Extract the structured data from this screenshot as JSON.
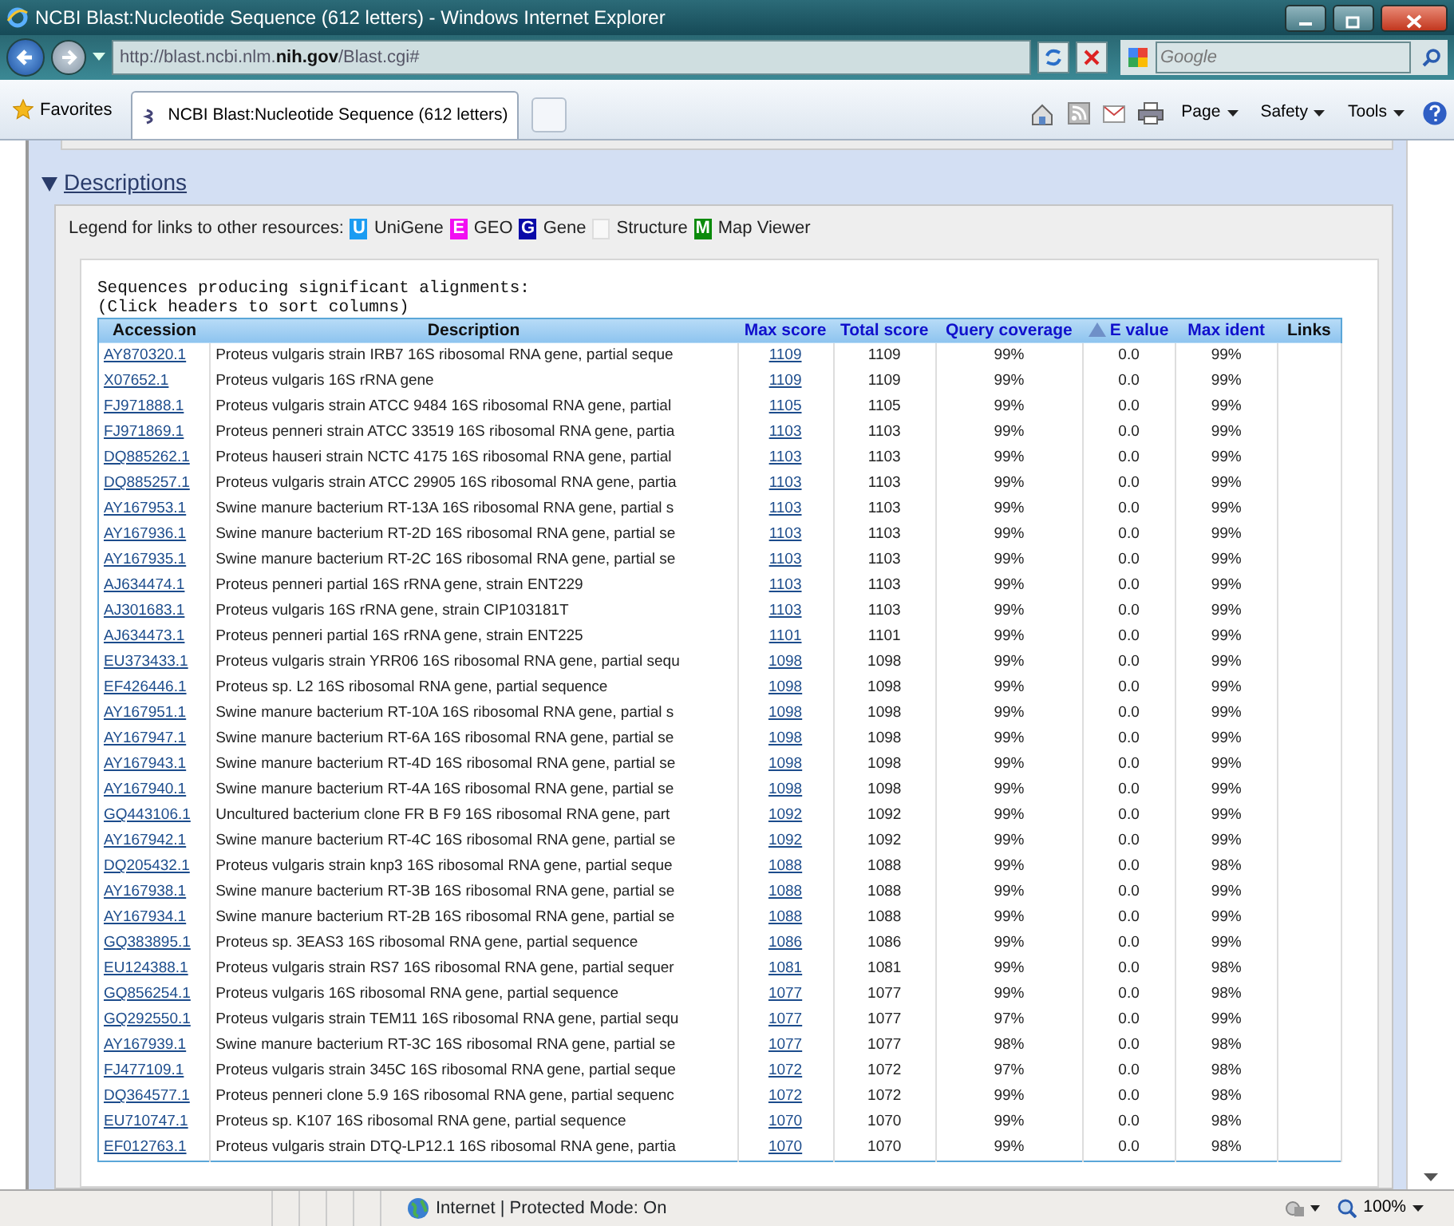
{
  "window": {
    "title": "NCBI Blast:Nucleotide Sequence (612 letters) - Windows Internet Explorer"
  },
  "address_bar": {
    "url": "http://blast.ncbi.nlm.**nih.gov**/Blast.cgi#"
  },
  "search": {
    "placeholder": "Google"
  },
  "favorites": "Favorites",
  "tabs": [
    {
      "label": "NCBI Blast:Nucleotide Sequence (612 letters)",
      "selected": true
    }
  ],
  "command_bar": [
    "Page",
    "Safety",
    "Tools"
  ],
  "section": {
    "title": "Descriptions",
    "expanded": true,
    "legend_label": "Legend for links to other resources:",
    "legend": [
      {
        "letter": "U",
        "label": "UniGene",
        "color": "#1a9cf2"
      },
      {
        "letter": "E",
        "label": "GEO",
        "color": "#f20ff2"
      },
      {
        "letter": "G",
        "label": "Gene",
        "color": "#0a0aa8"
      },
      {
        "label": "Structure"
      },
      {
        "letter": "M",
        "label": "Map Viewer",
        "color": "#0b8a0b"
      }
    ]
  },
  "results": {
    "caption": "Sequences producing significant alignments:",
    "hint": "(Click headers to sort columns)",
    "columns": [
      {
        "label": "Accession",
        "sortable": false,
        "sorted": false
      },
      {
        "label": "Description",
        "sortable": false,
        "sorted": false
      },
      {
        "label": "Max score",
        "sortable": true,
        "sorted": false
      },
      {
        "label": "Total score",
        "sortable": true,
        "sorted": false
      },
      {
        "label": "Query coverage",
        "sortable": true,
        "sorted": false
      },
      {
        "label": "E value",
        "sortable": true,
        "sorted": true
      },
      {
        "label": "Max ident",
        "sortable": true,
        "sorted": false
      },
      {
        "label": "Links",
        "sortable": false,
        "sorted": false
      }
    ],
    "rows": [
      [
        "AY870320.1",
        "Proteus vulgaris strain IRB7 16S ribosomal RNA gene, partial seque",
        "1109",
        "1109",
        "99%",
        "0.0",
        "99%"
      ],
      [
        "X07652.1",
        "Proteus vulgaris 16S rRNA gene",
        "1109",
        "1109",
        "99%",
        "0.0",
        "99%"
      ],
      [
        "FJ971888.1",
        "Proteus vulgaris strain ATCC 9484 16S ribosomal RNA gene, partial",
        "1105",
        "1105",
        "99%",
        "0.0",
        "99%"
      ],
      [
        "FJ971869.1",
        "Proteus penneri strain ATCC 33519 16S ribosomal RNA gene, partia",
        "1103",
        "1103",
        "99%",
        "0.0",
        "99%"
      ],
      [
        "DQ885262.1",
        "Proteus hauseri strain NCTC 4175 16S ribosomal RNA gene, partial",
        "1103",
        "1103",
        "99%",
        "0.0",
        "99%"
      ],
      [
        "DQ885257.1",
        "Proteus vulgaris strain ATCC 29905 16S ribosomal RNA gene, partia",
        "1103",
        "1103",
        "99%",
        "0.0",
        "99%"
      ],
      [
        "AY167953.1",
        "Swine manure bacterium RT-13A 16S ribosomal RNA gene, partial s",
        "1103",
        "1103",
        "99%",
        "0.0",
        "99%"
      ],
      [
        "AY167936.1",
        "Swine manure bacterium RT-2D 16S ribosomal RNA gene, partial se",
        "1103",
        "1103",
        "99%",
        "0.0",
        "99%"
      ],
      [
        "AY167935.1",
        "Swine manure bacterium RT-2C 16S ribosomal RNA gene, partial se",
        "1103",
        "1103",
        "99%",
        "0.0",
        "99%"
      ],
      [
        "AJ634474.1",
        "Proteus penneri partial 16S rRNA gene, strain ENT229",
        "1103",
        "1103",
        "99%",
        "0.0",
        "99%"
      ],
      [
        "AJ301683.1",
        "Proteus vulgaris 16S rRNA gene, strain CIP103181T",
        "1103",
        "1103",
        "99%",
        "0.0",
        "99%"
      ],
      [
        "AJ634473.1",
        "Proteus penneri partial 16S rRNA gene, strain ENT225",
        "1101",
        "1101",
        "99%",
        "0.0",
        "99%"
      ],
      [
        "EU373433.1",
        "Proteus vulgaris strain YRR06 16S ribosomal RNA gene, partial sequ",
        "1098",
        "1098",
        "99%",
        "0.0",
        "99%"
      ],
      [
        "EF426446.1",
        "Proteus sp. L2 16S ribosomal RNA gene, partial sequence",
        "1098",
        "1098",
        "99%",
        "0.0",
        "99%"
      ],
      [
        "AY167951.1",
        "Swine manure bacterium RT-10A 16S ribosomal RNA gene, partial s",
        "1098",
        "1098",
        "99%",
        "0.0",
        "99%"
      ],
      [
        "AY167947.1",
        "Swine manure bacterium RT-6A 16S ribosomal RNA gene, partial se",
        "1098",
        "1098",
        "99%",
        "0.0",
        "99%"
      ],
      [
        "AY167943.1",
        "Swine manure bacterium RT-4D 16S ribosomal RNA gene, partial se",
        "1098",
        "1098",
        "99%",
        "0.0",
        "99%"
      ],
      [
        "AY167940.1",
        "Swine manure bacterium RT-4A 16S ribosomal RNA gene, partial se",
        "1098",
        "1098",
        "99%",
        "0.0",
        "99%"
      ],
      [
        "GQ443106.1",
        "Uncultured bacterium clone FR B F9 16S ribosomal RNA gene, part",
        "1092",
        "1092",
        "99%",
        "0.0",
        "99%"
      ],
      [
        "AY167942.1",
        "Swine manure bacterium RT-4C 16S ribosomal RNA gene, partial se",
        "1092",
        "1092",
        "99%",
        "0.0",
        "99%"
      ],
      [
        "DQ205432.1",
        "Proteus vulgaris strain knp3 16S ribosomal RNA gene, partial seque",
        "1088",
        "1088",
        "99%",
        "0.0",
        "98%"
      ],
      [
        "AY167938.1",
        "Swine manure bacterium RT-3B 16S ribosomal RNA gene, partial se",
        "1088",
        "1088",
        "99%",
        "0.0",
        "99%"
      ],
      [
        "AY167934.1",
        "Swine manure bacterium RT-2B 16S ribosomal RNA gene, partial se",
        "1088",
        "1088",
        "99%",
        "0.0",
        "99%"
      ],
      [
        "GQ383895.1",
        "Proteus sp. 3EAS3 16S ribosomal RNA gene, partial sequence",
        "1086",
        "1086",
        "99%",
        "0.0",
        "99%"
      ],
      [
        "EU124388.1",
        "Proteus vulgaris strain RS7 16S ribosomal RNA gene, partial sequer",
        "1081",
        "1081",
        "99%",
        "0.0",
        "98%"
      ],
      [
        "GQ856254.1",
        "Proteus vulgaris 16S ribosomal RNA gene, partial sequence",
        "1077",
        "1077",
        "99%",
        "0.0",
        "98%"
      ],
      [
        "GQ292550.1",
        "Proteus vulgaris strain TEM11 16S ribosomal RNA gene, partial sequ",
        "1077",
        "1077",
        "97%",
        "0.0",
        "99%"
      ],
      [
        "AY167939.1",
        "Swine manure bacterium RT-3C 16S ribosomal RNA gene, partial se",
        "1077",
        "1077",
        "98%",
        "0.0",
        "98%"
      ],
      [
        "FJ477109.1",
        "Proteus vulgaris strain 345C 16S ribosomal RNA gene, partial seque",
        "1072",
        "1072",
        "97%",
        "0.0",
        "98%"
      ],
      [
        "DQ364577.1",
        "Proteus penneri clone 5.9 16S ribosomal RNA gene, partial sequenc",
        "1072",
        "1072",
        "99%",
        "0.0",
        "98%"
      ],
      [
        "EU710747.1",
        "Proteus sp. K107 16S ribosomal RNA gene, partial sequence",
        "1070",
        "1070",
        "99%",
        "0.0",
        "98%"
      ],
      [
        "EF012763.1",
        "Proteus vulgaris strain DTQ-LP12.1 16S ribosomal RNA gene, partia",
        "1070",
        "1070",
        "99%",
        "0.0",
        "98%"
      ]
    ]
  },
  "status_bar": {
    "zone": "Internet | Protected Mode: On",
    "zoom": "100%"
  }
}
